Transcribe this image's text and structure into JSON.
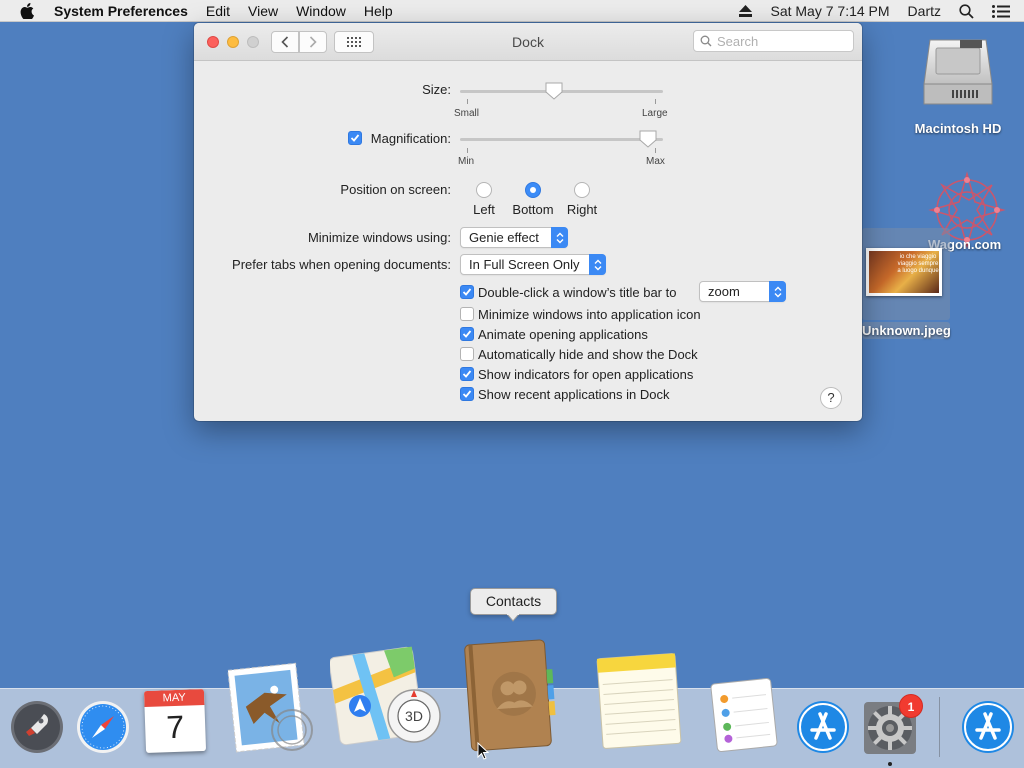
{
  "menubar": {
    "app_name": "System Preferences",
    "items": [
      "Edit",
      "View",
      "Window",
      "Help"
    ],
    "datetime": "Sat May 7  7:14 PM",
    "user": "Dartz"
  },
  "desktop": {
    "hd_label": "Macintosh HD",
    "wagon_label": "Wagon.com",
    "jpeg_label": "Unknown.jpeg",
    "jpeg_caption": "io che viaggio viaggio sempre a luogo dunque"
  },
  "window": {
    "title": "Dock",
    "search_placeholder": "Search",
    "size": {
      "label": "Size:",
      "min_label": "Small",
      "max_label": "Large",
      "value": 0.46
    },
    "magnification": {
      "label": "Magnification:",
      "checked": true,
      "min_label": "Min",
      "max_label": "Max",
      "value": 0.97
    },
    "position": {
      "label": "Position on screen:",
      "options": [
        "Left",
        "Bottom",
        "Right"
      ],
      "selected": "Bottom"
    },
    "minimize": {
      "label": "Minimize windows using:",
      "value": "Genie effect"
    },
    "prefer_tabs": {
      "label": "Prefer tabs when opening documents:",
      "value": "In Full Screen Only"
    },
    "double_click": {
      "label": "Double-click a window’s title bar to",
      "checked": true,
      "value": "zoom"
    },
    "checkboxes": [
      {
        "label": "Minimize windows into application icon",
        "checked": false
      },
      {
        "label": "Animate opening applications",
        "checked": true
      },
      {
        "label": "Automatically hide and show the Dock",
        "checked": false
      },
      {
        "label": "Show indicators for open applications",
        "checked": true
      },
      {
        "label": "Show recent applications in Dock",
        "checked": true
      }
    ],
    "help_label": "?"
  },
  "tooltip": {
    "text": "Contacts"
  },
  "dock": {
    "apps": [
      "Launchpad",
      "Safari",
      "Calendar",
      "Mail",
      "Maps",
      "Contacts",
      "Notes",
      "Reminders",
      "App Store",
      "System Preferences",
      "App Store"
    ],
    "calendar_month": "MAY",
    "calendar_day": "7",
    "maps_3d": "3D",
    "sysprefs_badge": "1"
  },
  "colors": {
    "accent": "#3b89f4",
    "desktop": "#4f7fbf",
    "badge": "#f13b30"
  }
}
